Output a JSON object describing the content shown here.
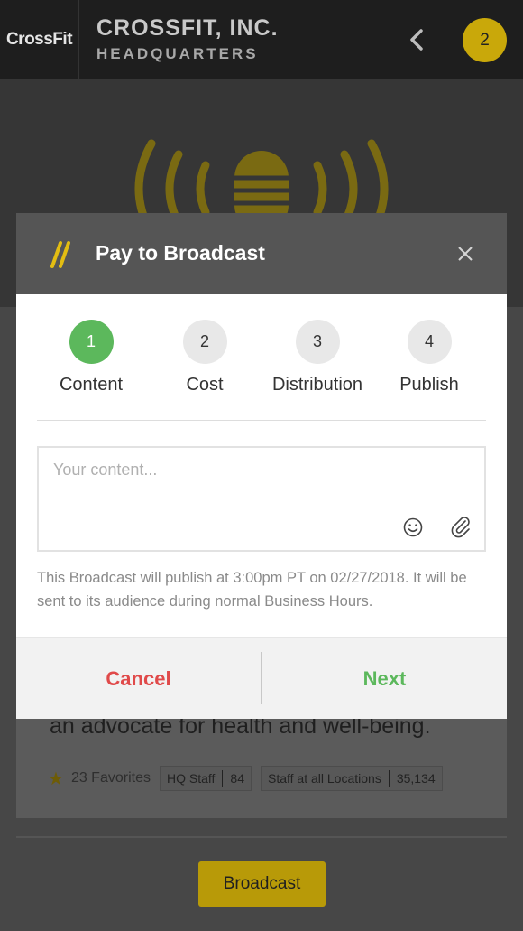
{
  "header": {
    "logo_text": "CrossFit",
    "org_name": "CROSSFIT, INC.",
    "org_subtitle": "HEADQUARTERS",
    "notification_count": "2"
  },
  "card": {
    "description_tail": "an advocate for health and well-being.",
    "favorites": "23 Favorites",
    "tags": [
      {
        "label": "HQ Staff",
        "count": "84"
      },
      {
        "label": "Staff at all Locations",
        "count": "35,134"
      }
    ]
  },
  "broadcast_button": "Broadcast",
  "modal": {
    "title": "Pay to Broadcast",
    "steps": [
      {
        "number": "1",
        "label": "Content",
        "active": true
      },
      {
        "number": "2",
        "label": "Cost",
        "active": false
      },
      {
        "number": "3",
        "label": "Distribution",
        "active": false
      },
      {
        "number": "4",
        "label": "Publish",
        "active": false
      }
    ],
    "content_placeholder": "Your content...",
    "note": "This Broadcast will publish at 3:00pm PT on 02/27/2018. It will be sent to its audience during normal Business Hours.",
    "cancel_label": "Cancel",
    "next_label": "Next"
  },
  "colors": {
    "brand_yellow": "#e3bd12",
    "active_step": "#5cb85c",
    "cancel": "#e04a4a",
    "next": "#5cb85c"
  },
  "icons": [
    "crossfit-logo",
    "back-chevron-icon",
    "broadcast-mic-icon",
    "slash-logo-icon",
    "close-icon",
    "smiley-icon",
    "paperclip-icon",
    "star-icon"
  ]
}
